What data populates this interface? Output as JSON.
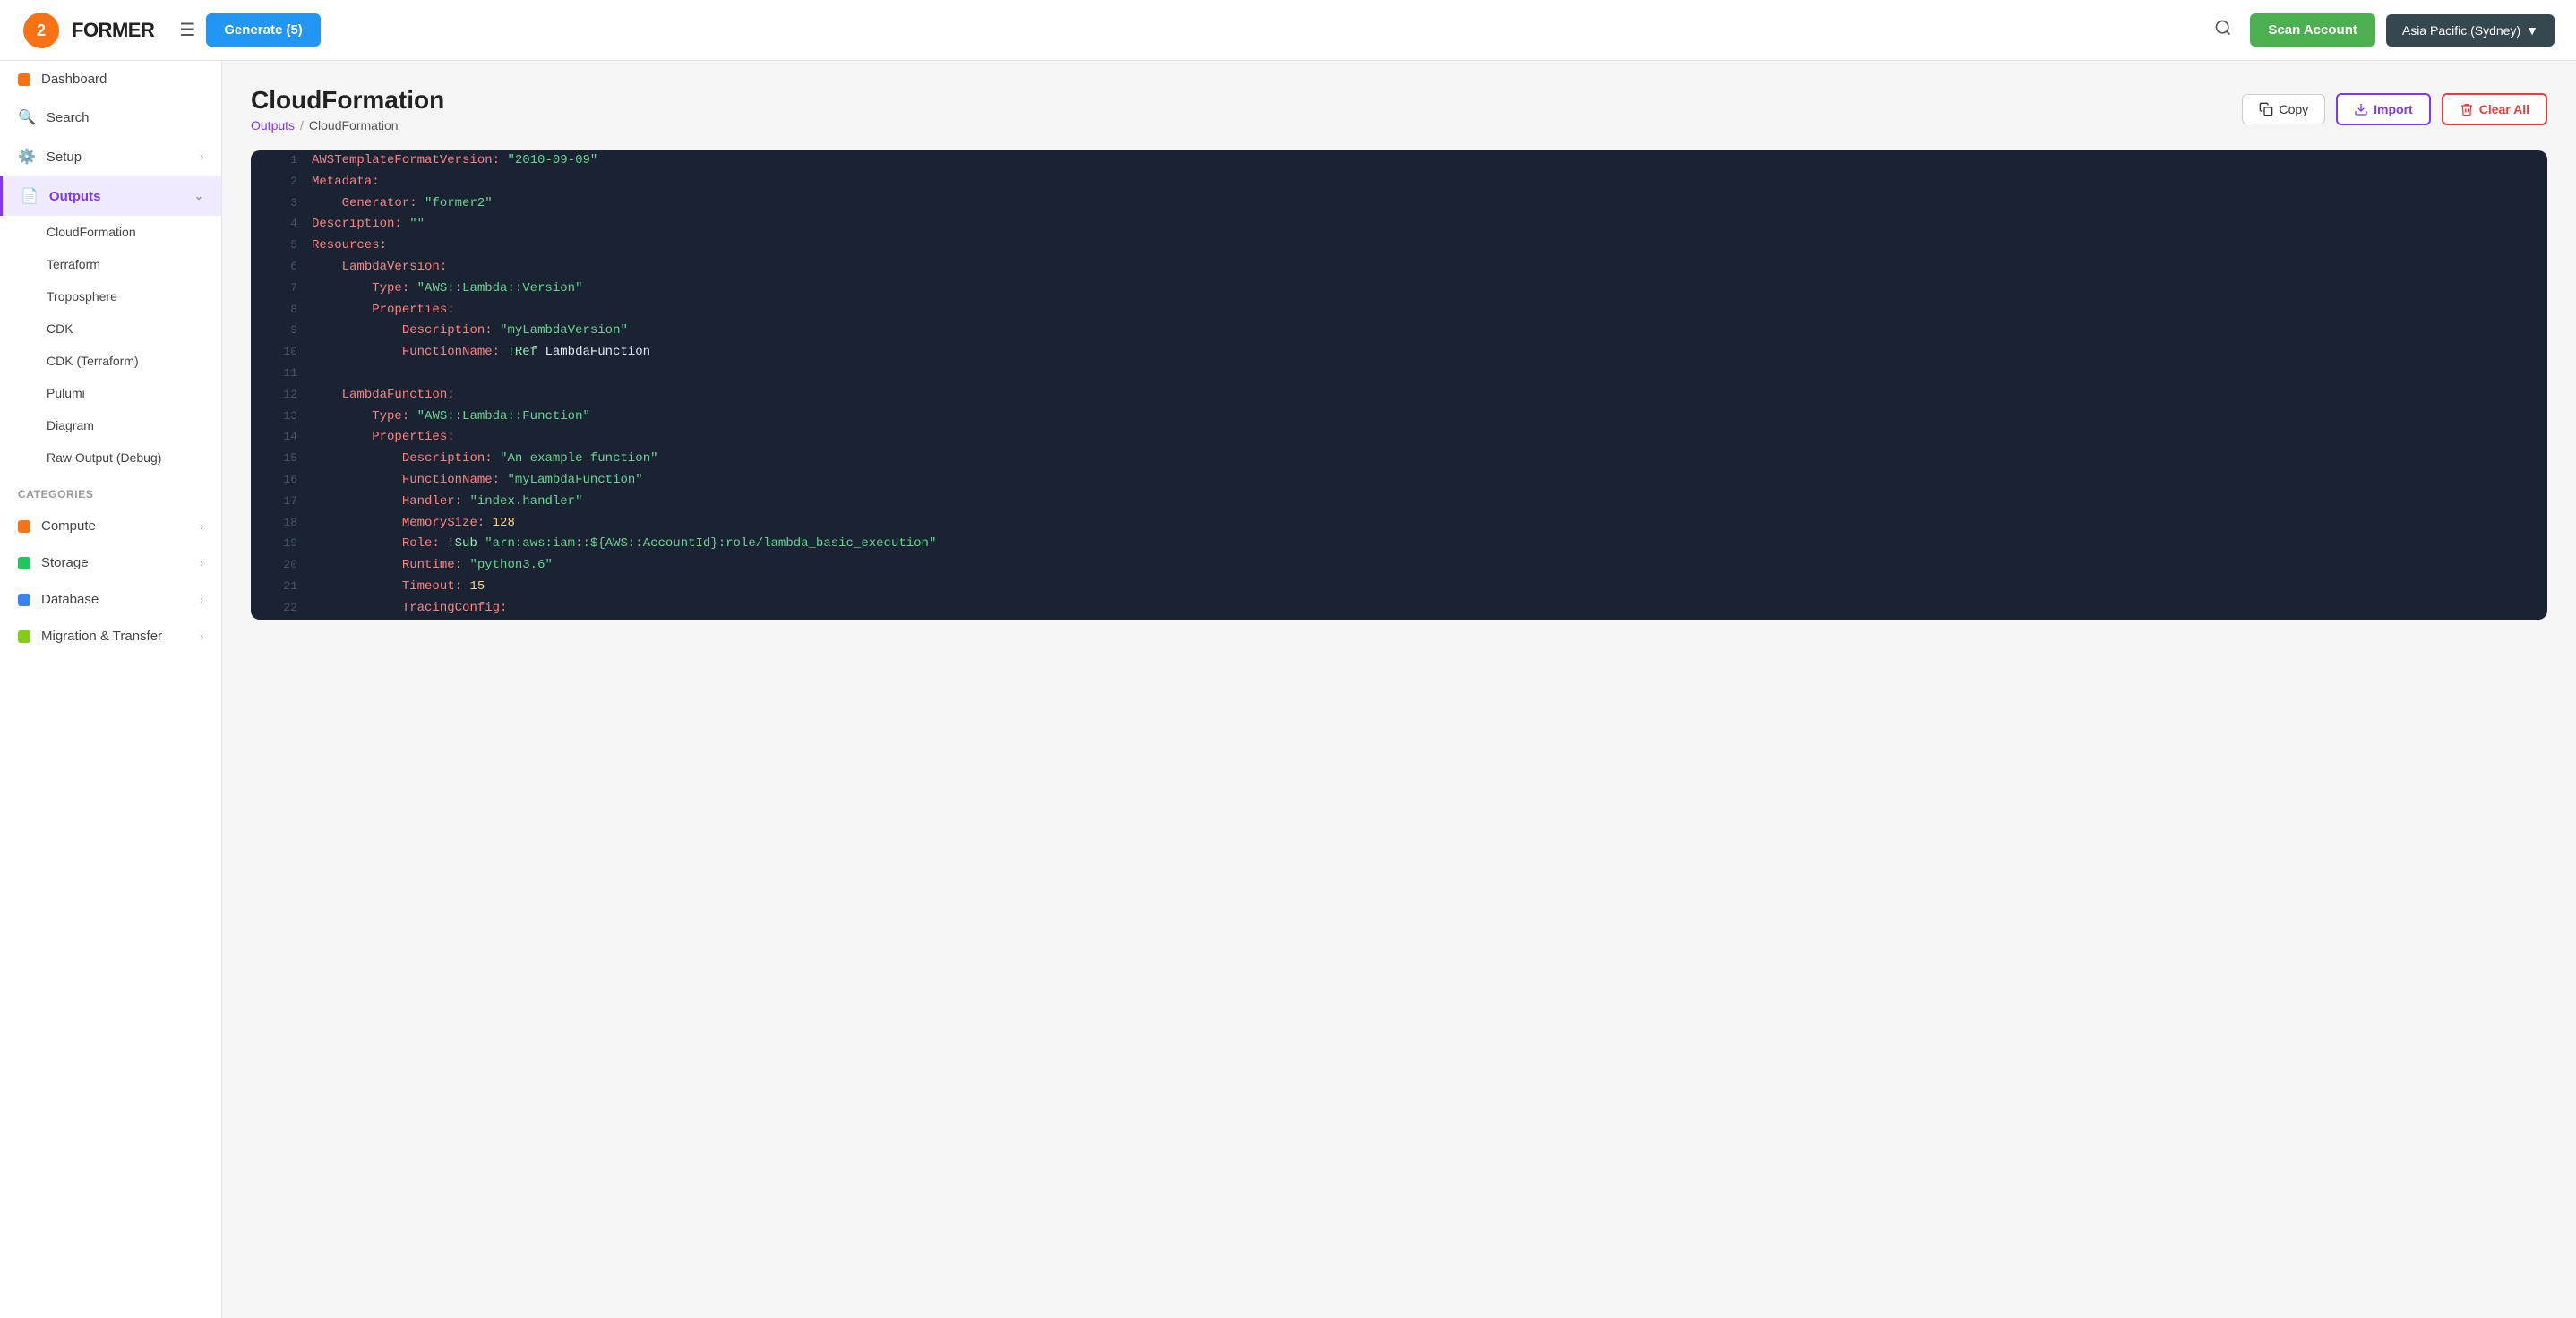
{
  "topnav": {
    "generate_label": "Generate (5)",
    "scan_account_label": "Scan Account",
    "region_label": "Asia Pacific (Sydney)",
    "region_arrow": "▼"
  },
  "sidebar": {
    "main_items": [
      {
        "id": "dashboard",
        "label": "Dashboard",
        "icon": "🟧",
        "has_chevron": false
      },
      {
        "id": "search",
        "label": "Search",
        "icon": "🔍",
        "has_chevron": false
      },
      {
        "id": "setup",
        "label": "Setup",
        "icon": "⚙️",
        "has_chevron": true
      },
      {
        "id": "outputs",
        "label": "Outputs",
        "icon": "📄",
        "has_chevron": true,
        "active": true
      }
    ],
    "output_sub_items": [
      {
        "id": "cloudformation",
        "label": "CloudFormation"
      },
      {
        "id": "terraform",
        "label": "Terraform"
      },
      {
        "id": "troposphere",
        "label": "Troposphere"
      },
      {
        "id": "cdk",
        "label": "CDK"
      },
      {
        "id": "cdk-terraform",
        "label": "CDK (Terraform)"
      },
      {
        "id": "pulumi",
        "label": "Pulumi"
      },
      {
        "id": "diagram",
        "label": "Diagram"
      },
      {
        "id": "raw-output",
        "label": "Raw Output (Debug)"
      }
    ],
    "categories_label": "CATEGORIES",
    "category_items": [
      {
        "id": "compute",
        "label": "Compute",
        "dot_class": "dot-orange"
      },
      {
        "id": "storage",
        "label": "Storage",
        "dot_class": "dot-green"
      },
      {
        "id": "database",
        "label": "Database",
        "dot_class": "dot-blue"
      },
      {
        "id": "migration",
        "label": "Migration & Transfer",
        "dot_class": "dot-lime"
      }
    ]
  },
  "page": {
    "title": "CloudFormation",
    "breadcrumb_outputs": "Outputs",
    "breadcrumb_sep": "/",
    "breadcrumb_current": "CloudFormation"
  },
  "actions": {
    "copy_label": "Copy",
    "import_label": "Import",
    "clear_label": "Clear All"
  },
  "code": {
    "lines": [
      {
        "num": 1,
        "text": "AWSTemplateFormatVersion: \"2010-09-09\""
      },
      {
        "num": 2,
        "text": "Metadata:"
      },
      {
        "num": 3,
        "text": "    Generator: \"former2\""
      },
      {
        "num": 4,
        "text": "Description: \"\""
      },
      {
        "num": 5,
        "text": "Resources:"
      },
      {
        "num": 6,
        "text": "    LambdaVersion:"
      },
      {
        "num": 7,
        "text": "        Type: \"AWS::Lambda::Version\""
      },
      {
        "num": 8,
        "text": "        Properties:"
      },
      {
        "num": 9,
        "text": "            Description: \"myLambdaVersion\""
      },
      {
        "num": 10,
        "text": "            FunctionName: !Ref LambdaFunction"
      },
      {
        "num": 11,
        "text": ""
      },
      {
        "num": 12,
        "text": "    LambdaFunction:"
      },
      {
        "num": 13,
        "text": "        Type: \"AWS::Lambda::Function\""
      },
      {
        "num": 14,
        "text": "        Properties:"
      },
      {
        "num": 15,
        "text": "            Description: \"An example function\""
      },
      {
        "num": 16,
        "text": "            FunctionName: \"myLambdaFunction\""
      },
      {
        "num": 17,
        "text": "            Handler: \"index.handler\""
      },
      {
        "num": 18,
        "text": "            MemorySize: 128"
      },
      {
        "num": 19,
        "text": "            Role: !Sub \"arn:aws:iam::${AWS::AccountId}:role/lambda_basic_execution\""
      },
      {
        "num": 20,
        "text": "            Runtime: \"python3.6\""
      },
      {
        "num": 21,
        "text": "            Timeout: 15"
      },
      {
        "num": 22,
        "text": "            TracingConfig:"
      }
    ]
  }
}
